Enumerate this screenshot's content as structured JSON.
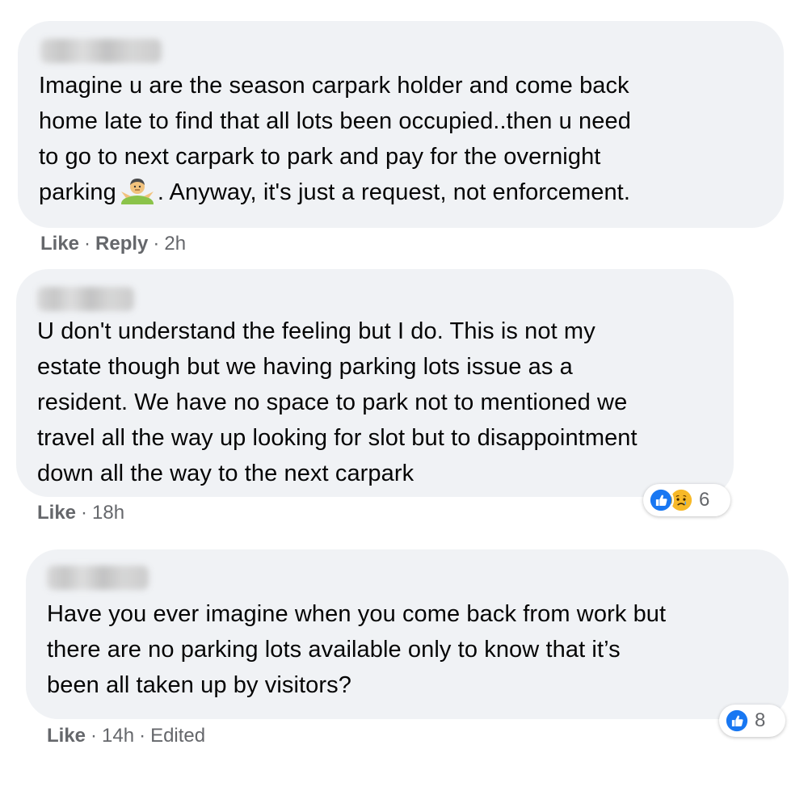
{
  "comments": [
    {
      "lines": [
        "Imagine u are the season carpark holder and come back",
        "home late to find that all lots been occupied..then u need",
        "to go to next carpark to park and pay for the overnight",
        "parking",
        ". Anyway, it's just a request, not enforcement."
      ],
      "emoji": "man-shrugging-emoji",
      "like_label": "Like",
      "reply_label": "Reply",
      "separator": "·",
      "time": "2h"
    },
    {
      "lines": [
        "U don't understand the feeling but I do. This is not my",
        "estate though but we having parking lots issue as a",
        "resident. We have no space to park not to mentioned we",
        "travel all the way up looking for slot but to disappointment",
        "down all the way to the next carpark"
      ],
      "like_label": "Like",
      "separator": "·",
      "time": "18h",
      "reactions": {
        "icons": [
          "like-reaction-icon",
          "sad-reaction-icon"
        ],
        "count": "6"
      }
    },
    {
      "lines": [
        "Have you ever imagine when you come back from work but",
        "there are no parking lots available only to know that it’s",
        "been all taken up by visitors?"
      ],
      "like_label": "Like",
      "separator": "·",
      "time": "14h",
      "edited_label": "Edited",
      "reactions": {
        "icons": [
          "like-reaction-icon"
        ],
        "count": "8"
      }
    }
  ],
  "colors": {
    "bubble": "#f0f2f5",
    "meta_text": "#65676b",
    "like_blue": "#1877f2",
    "sad_yellow": "#f7b928"
  }
}
